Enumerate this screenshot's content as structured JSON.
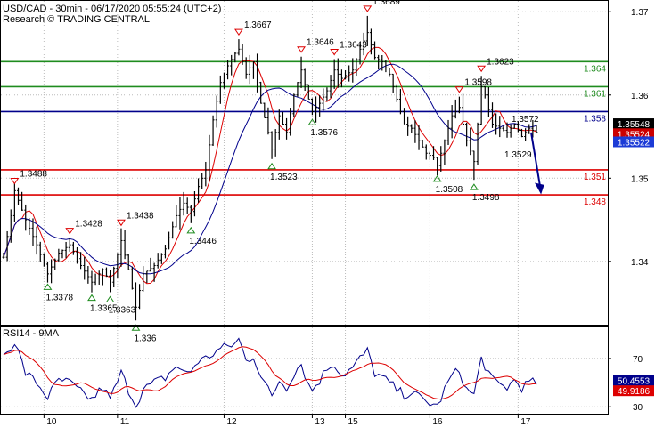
{
  "header": {
    "line1": "USD/CAD - 30min - 06/17/2020 05:55:24 (UTC+2)",
    "line2": "Research © TRADING CENTRAL"
  },
  "rsi_panel": {
    "label": "RSI14 - 9MA"
  },
  "colors": {
    "resistance": "#1f8c1f",
    "pivot": "#00008b",
    "support": "#dd0000",
    "price": "#000000",
    "ma_fast": "#dd0000",
    "ma_slow": "#00008b",
    "grid": "#bcbcbc",
    "current_price_bg": "#000000",
    "bid_bg": "#cc0000",
    "ask_bg": "#1c3bd6",
    "rsi_line": "#00008b",
    "rsi_ma": "#dd0000",
    "rsi_value_bg": "#00008b",
    "rsi_ma_value_bg": "#dd0000",
    "up_marker": "#1f8c1f",
    "down_marker": "#dd0000",
    "arrow": "#00008b"
  },
  "chart_data": {
    "type": "line",
    "symbol": "USD/CAD",
    "timeframe": "30min",
    "date_labels": [
      "10",
      "11",
      "12",
      "13",
      "15",
      "16",
      "17"
    ],
    "y_ticks": [
      1.34,
      1.35,
      1.36,
      1.37
    ],
    "ylim": [
      1.3325,
      1.3712
    ],
    "key_levels": [
      {
        "value": 1.364,
        "label": "1.364",
        "type": "resistance"
      },
      {
        "value": 1.361,
        "label": "1.361",
        "type": "resistance"
      },
      {
        "value": 1.358,
        "label": "1.358",
        "type": "pivot"
      },
      {
        "value": 1.351,
        "label": "1.351",
        "type": "support"
      },
      {
        "value": 1.348,
        "label": "1.348",
        "type": "support"
      }
    ],
    "price_tags": [
      {
        "value": 1.35548,
        "label": "1.35548",
        "kind": "current"
      },
      {
        "value": 1.35524,
        "label": "1.35524",
        "kind": "bid"
      },
      {
        "value": 1.35522,
        "label": "1.35522",
        "kind": "ask"
      }
    ],
    "swing_points": [
      {
        "bar": 3,
        "value": 1.3488,
        "label": "1.3488",
        "kind": "high"
      },
      {
        "bar": 12,
        "value": 1.3378,
        "label": "1.3378",
        "kind": "low"
      },
      {
        "bar": 18,
        "value": 1.3428,
        "label": "1.3428",
        "kind": "high"
      },
      {
        "bar": 24,
        "value": 1.3365,
        "label": "1.3365",
        "kind": "low"
      },
      {
        "bar": 29,
        "value": 1.3363,
        "label": "1.3363",
        "kind": "low"
      },
      {
        "bar": 32,
        "value": 1.3438,
        "label": "1.3438",
        "kind": "high"
      },
      {
        "bar": 36,
        "value": 1.3329,
        "label": "1.336",
        "kind": "low"
      },
      {
        "bar": 51,
        "value": 1.3446,
        "label": "1.3446",
        "kind": "low"
      },
      {
        "bar": 64,
        "value": 1.3667,
        "label": "1.3667",
        "kind": "high"
      },
      {
        "bar": 73,
        "value": 1.3523,
        "label": "1.3523",
        "kind": "low"
      },
      {
        "bar": 81,
        "value": 1.3646,
        "label": "1.3646",
        "kind": "high"
      },
      {
        "bar": 84,
        "value": 1.3576,
        "label": "1.3576",
        "kind": "low"
      },
      {
        "bar": 90,
        "value": 1.3643,
        "label": "1.3643",
        "kind": "high"
      },
      {
        "bar": 99,
        "value": 1.3695,
        "label": "1.3689",
        "kind": "high"
      },
      {
        "bar": 118,
        "value": 1.3508,
        "label": "1.3508",
        "kind": "low"
      },
      {
        "bar": 124,
        "value": 1.3598,
        "label": "1.3598",
        "kind": "high"
      },
      {
        "bar": 128,
        "value": 1.3498,
        "label": "1.3498",
        "kind": "low"
      },
      {
        "bar": 130,
        "value": 1.3623,
        "label": "1.3623",
        "kind": "high"
      }
    ],
    "projection": {
      "from": 1.3555,
      "to": 1.3484,
      "label_above": "1.3572",
      "label_below": "1.3529",
      "label_above_value": 1.3572,
      "label_below_value": 1.3529
    },
    "close_anchors": [
      [
        0,
        1.3405
      ],
      [
        2,
        1.3455
      ],
      [
        3,
        1.3485
      ],
      [
        6,
        1.345
      ],
      [
        9,
        1.342
      ],
      [
        12,
        1.3385
      ],
      [
        15,
        1.341
      ],
      [
        18,
        1.342
      ],
      [
        21,
        1.3395
      ],
      [
        24,
        1.3375
      ],
      [
        27,
        1.339
      ],
      [
        29,
        1.3375
      ],
      [
        32,
        1.3425
      ],
      [
        34,
        1.339
      ],
      [
        36,
        1.3345
      ],
      [
        38,
        1.3385
      ],
      [
        41,
        1.3395
      ],
      [
        44,
        1.3415
      ],
      [
        47,
        1.3455
      ],
      [
        49,
        1.347
      ],
      [
        51,
        1.346
      ],
      [
        53,
        1.349
      ],
      [
        55,
        1.351
      ],
      [
        57,
        1.357
      ],
      [
        59,
        1.3615
      ],
      [
        61,
        1.3635
      ],
      [
        63,
        1.365
      ],
      [
        64,
        1.3655
      ],
      [
        66,
        1.3625
      ],
      [
        68,
        1.364
      ],
      [
        70,
        1.359
      ],
      [
        72,
        1.3555
      ],
      [
        73,
        1.3535
      ],
      [
        75,
        1.3575
      ],
      [
        77,
        1.3555
      ],
      [
        79,
        1.36
      ],
      [
        81,
        1.363
      ],
      [
        83,
        1.3595
      ],
      [
        84,
        1.358
      ],
      [
        86,
        1.359
      ],
      [
        88,
        1.3605
      ],
      [
        90,
        1.363
      ],
      [
        92,
        1.362
      ],
      [
        95,
        1.363
      ],
      [
        97,
        1.3655
      ],
      [
        99,
        1.3675
      ],
      [
        101,
        1.3645
      ],
      [
        103,
        1.364
      ],
      [
        105,
        1.3625
      ],
      [
        107,
        1.3595
      ],
      [
        109,
        1.3565
      ],
      [
        111,
        1.356
      ],
      [
        113,
        1.3545
      ],
      [
        115,
        1.353
      ],
      [
        117,
        1.3525
      ],
      [
        118,
        1.3515
      ],
      [
        120,
        1.3545
      ],
      [
        122,
        1.3575
      ],
      [
        124,
        1.3585
      ],
      [
        126,
        1.3545
      ],
      [
        128,
        1.352
      ],
      [
        130,
        1.361
      ],
      [
        131,
        1.36
      ],
      [
        133,
        1.3565
      ],
      [
        135,
        1.356
      ],
      [
        137,
        1.3555
      ],
      [
        139,
        1.3565
      ],
      [
        141,
        1.355
      ],
      [
        143,
        1.356
      ],
      [
        145,
        1.3555
      ]
    ],
    "rsi": {
      "ticks": [
        30,
        70
      ],
      "ylim": [
        25,
        95
      ],
      "value": 50.4553,
      "value_label": "50.4553",
      "ma_value": 49.9186,
      "ma_label": "49.9186",
      "anchors": [
        [
          0,
          72
        ],
        [
          3,
          84
        ],
        [
          6,
          58
        ],
        [
          9,
          50
        ],
        [
          12,
          38
        ],
        [
          15,
          52
        ],
        [
          18,
          50
        ],
        [
          21,
          42
        ],
        [
          24,
          36
        ],
        [
          27,
          46
        ],
        [
          29,
          36
        ],
        [
          32,
          58
        ],
        [
          34,
          44
        ],
        [
          36,
          32
        ],
        [
          38,
          44
        ],
        [
          41,
          50
        ],
        [
          44,
          54
        ],
        [
          47,
          64
        ],
        [
          49,
          58
        ],
        [
          51,
          60
        ],
        [
          53,
          68
        ],
        [
          55,
          70
        ],
        [
          57,
          74
        ],
        [
          59,
          78
        ],
        [
          61,
          80
        ],
        [
          63,
          82
        ],
        [
          64,
          86
        ],
        [
          66,
          68
        ],
        [
          68,
          72
        ],
        [
          70,
          56
        ],
        [
          72,
          44
        ],
        [
          73,
          38
        ],
        [
          75,
          52
        ],
        [
          77,
          46
        ],
        [
          79,
          58
        ],
        [
          81,
          66
        ],
        [
          83,
          48
        ],
        [
          84,
          44
        ],
        [
          86,
          52
        ],
        [
          88,
          62
        ],
        [
          90,
          66
        ],
        [
          92,
          56
        ],
        [
          95,
          62
        ],
        [
          97,
          70
        ],
        [
          99,
          76
        ],
        [
          101,
          58
        ],
        [
          103,
          54
        ],
        [
          105,
          50
        ],
        [
          107,
          44
        ],
        [
          109,
          40
        ],
        [
          111,
          42
        ],
        [
          113,
          38
        ],
        [
          115,
          34
        ],
        [
          117,
          32
        ],
        [
          118,
          30
        ],
        [
          120,
          44
        ],
        [
          122,
          56
        ],
        [
          124,
          60
        ],
        [
          126,
          44
        ],
        [
          128,
          40
        ],
        [
          130,
          70
        ],
        [
          131,
          64
        ],
        [
          133,
          52
        ],
        [
          135,
          48
        ],
        [
          137,
          46
        ],
        [
          139,
          52
        ],
        [
          141,
          46
        ],
        [
          143,
          50
        ],
        [
          145,
          50
        ]
      ]
    }
  }
}
